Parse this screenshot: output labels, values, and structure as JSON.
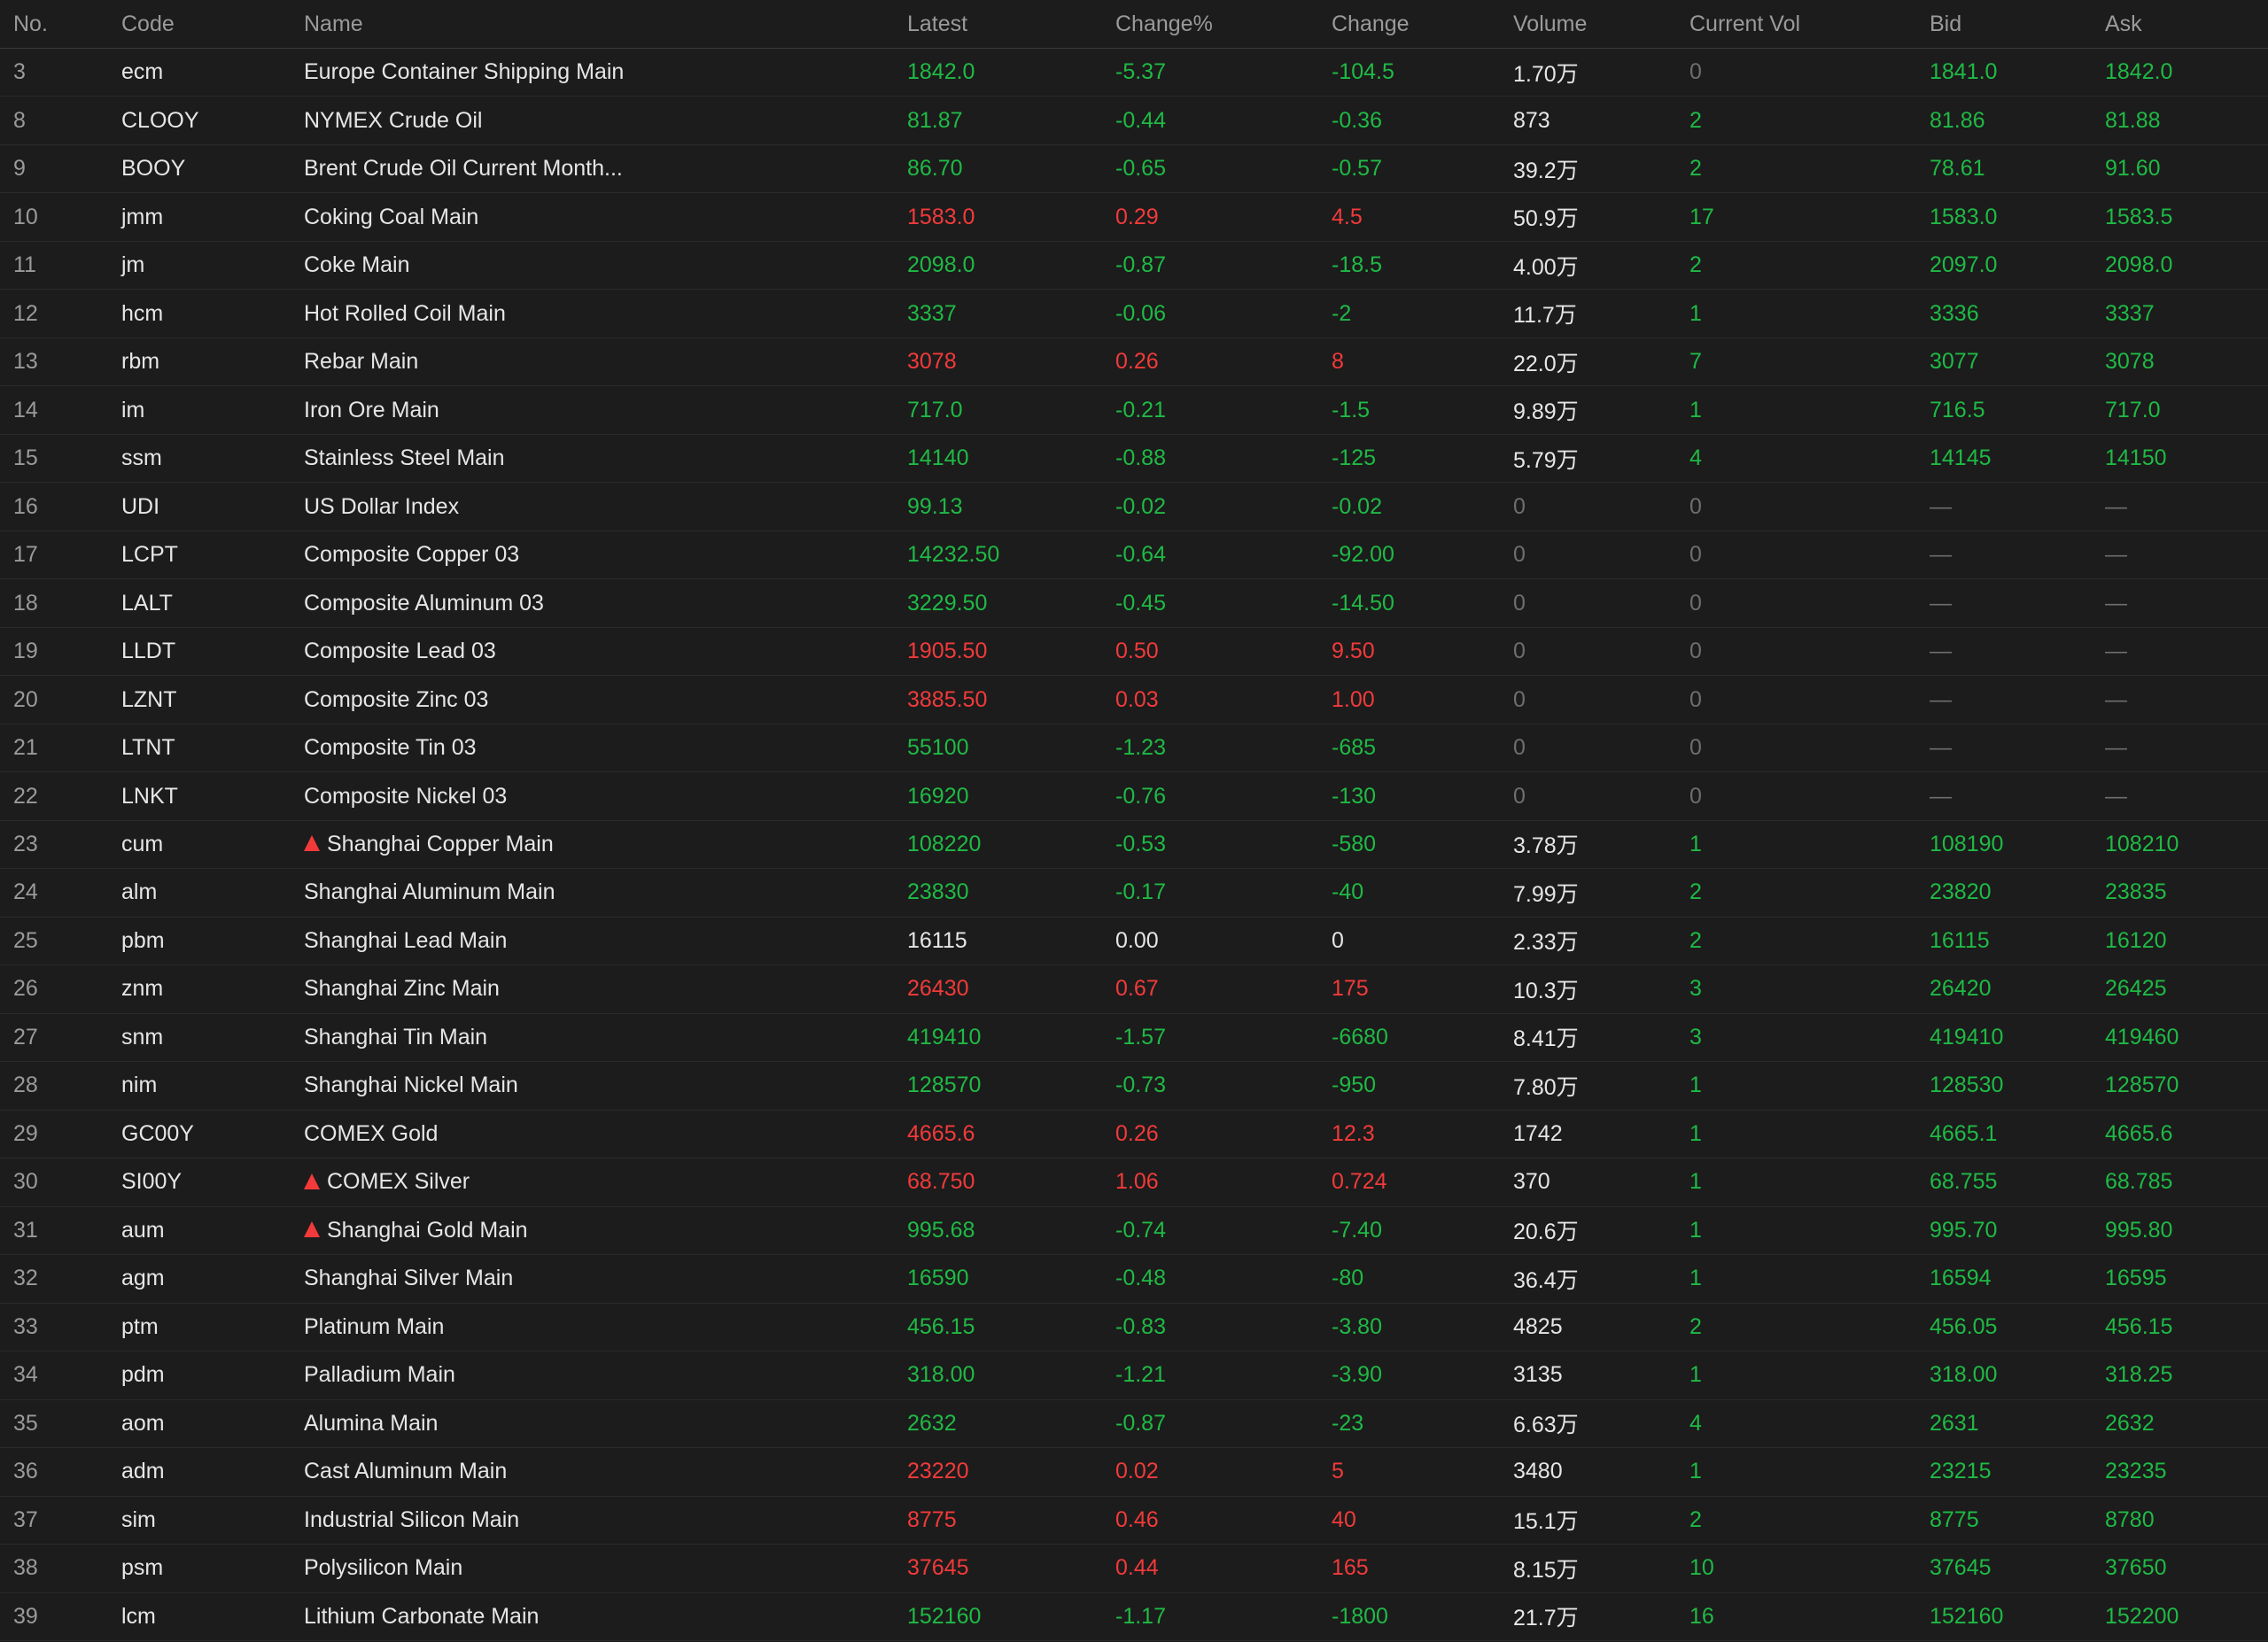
{
  "colors": {
    "background": "#1c1c1c",
    "up": "#f23a3a",
    "down": "#1fba45",
    "text": "#e6e6e6",
    "muted": "#6e6e6e",
    "header_text": "#9a9a9a"
  },
  "table": {
    "headers": {
      "no": "No.",
      "code": "Code",
      "name": "Name",
      "latest": "Latest",
      "change_pct": "Change%",
      "change": "Change",
      "volume": "Volume",
      "current_vol": "Current Vol",
      "bid": "Bid",
      "ask": "Ask"
    },
    "rows": [
      {
        "no": "3",
        "code": "ecm",
        "name": "Europe Container Shipping Main",
        "alert": false,
        "latest": "1842.0",
        "change_pct": "-5.37",
        "change": "-104.5",
        "volume": "1.70万",
        "current_vol": "0",
        "bid": "1841.0",
        "ask": "1842.0",
        "dir": "down"
      },
      {
        "no": "8",
        "code": "CLOOY",
        "name": "NYMEX Crude Oil",
        "alert": false,
        "latest": "81.87",
        "change_pct": "-0.44",
        "change": "-0.36",
        "volume": "873",
        "current_vol": "2",
        "bid": "81.86",
        "ask": "81.88",
        "dir": "down"
      },
      {
        "no": "9",
        "code": "BOOY",
        "name": "Brent Crude Oil Current Month...",
        "alert": false,
        "latest": "86.70",
        "change_pct": "-0.65",
        "change": "-0.57",
        "volume": "39.2万",
        "current_vol": "2",
        "bid": "78.61",
        "ask": "91.60",
        "dir": "down"
      },
      {
        "no": "10",
        "code": "jmm",
        "name": "Coking Coal Main",
        "alert": false,
        "latest": "1583.0",
        "change_pct": "0.29",
        "change": "4.5",
        "volume": "50.9万",
        "current_vol": "17",
        "bid": "1583.0",
        "ask": "1583.5",
        "dir": "up"
      },
      {
        "no": "11",
        "code": "jm",
        "name": "Coke Main",
        "alert": false,
        "latest": "2098.0",
        "change_pct": "-0.87",
        "change": "-18.5",
        "volume": "4.00万",
        "current_vol": "2",
        "bid": "2097.0",
        "ask": "2098.0",
        "dir": "down"
      },
      {
        "no": "12",
        "code": "hcm",
        "name": "Hot Rolled Coil Main",
        "alert": false,
        "latest": "3337",
        "change_pct": "-0.06",
        "change": "-2",
        "volume": "11.7万",
        "current_vol": "1",
        "bid": "3336",
        "ask": "3337",
        "dir": "down"
      },
      {
        "no": "13",
        "code": "rbm",
        "name": "Rebar Main",
        "alert": false,
        "latest": "3078",
        "change_pct": "0.26",
        "change": "8",
        "volume": "22.0万",
        "current_vol": "7",
        "bid": "3077",
        "ask": "3078",
        "dir": "up"
      },
      {
        "no": "14",
        "code": "im",
        "name": "Iron Ore Main",
        "alert": false,
        "latest": "717.0",
        "change_pct": "-0.21",
        "change": "-1.5",
        "volume": "9.89万",
        "current_vol": "1",
        "bid": "716.5",
        "ask": "717.0",
        "dir": "down"
      },
      {
        "no": "15",
        "code": "ssm",
        "name": "Stainless Steel Main",
        "alert": false,
        "latest": "14140",
        "change_pct": "-0.88",
        "change": "-125",
        "volume": "5.79万",
        "current_vol": "4",
        "bid": "14145",
        "ask": "14150",
        "dir": "down"
      },
      {
        "no": "16",
        "code": "UDI",
        "name": "US Dollar Index",
        "alert": false,
        "latest": "99.13",
        "change_pct": "-0.02",
        "change": "-0.02",
        "volume": "0",
        "current_vol": "0",
        "bid": "—",
        "ask": "—",
        "dir": "down"
      },
      {
        "no": "17",
        "code": "LCPT",
        "name": "Composite Copper 03",
        "alert": false,
        "latest": "14232.50",
        "change_pct": "-0.64",
        "change": "-92.00",
        "volume": "0",
        "current_vol": "0",
        "bid": "—",
        "ask": "—",
        "dir": "down"
      },
      {
        "no": "18",
        "code": "LALT",
        "name": "Composite Aluminum 03",
        "alert": false,
        "latest": "3229.50",
        "change_pct": "-0.45",
        "change": "-14.50",
        "volume": "0",
        "current_vol": "0",
        "bid": "—",
        "ask": "—",
        "dir": "down"
      },
      {
        "no": "19",
        "code": "LLDT",
        "name": "Composite Lead 03",
        "alert": false,
        "latest": "1905.50",
        "change_pct": "0.50",
        "change": "9.50",
        "volume": "0",
        "current_vol": "0",
        "bid": "—",
        "ask": "—",
        "dir": "up"
      },
      {
        "no": "20",
        "code": "LZNT",
        "name": "Composite Zinc 03",
        "alert": false,
        "latest": "3885.50",
        "change_pct": "0.03",
        "change": "1.00",
        "volume": "0",
        "current_vol": "0",
        "bid": "—",
        "ask": "—",
        "dir": "up"
      },
      {
        "no": "21",
        "code": "LTNT",
        "name": "Composite Tin 03",
        "alert": false,
        "latest": "55100",
        "change_pct": "-1.23",
        "change": "-685",
        "volume": "0",
        "current_vol": "0",
        "bid": "—",
        "ask": "—",
        "dir": "down"
      },
      {
        "no": "22",
        "code": "LNKT",
        "name": "Composite Nickel 03",
        "alert": false,
        "latest": "16920",
        "change_pct": "-0.76",
        "change": "-130",
        "volume": "0",
        "current_vol": "0",
        "bid": "—",
        "ask": "—",
        "dir": "down"
      },
      {
        "no": "23",
        "code": "cum",
        "name": "Shanghai Copper Main",
        "alert": true,
        "latest": "108220",
        "change_pct": "-0.53",
        "change": "-580",
        "volume": "3.78万",
        "current_vol": "1",
        "bid": "108190",
        "ask": "108210",
        "dir": "down"
      },
      {
        "no": "24",
        "code": "alm",
        "name": "Shanghai Aluminum Main",
        "alert": false,
        "latest": "23830",
        "change_pct": "-0.17",
        "change": "-40",
        "volume": "7.99万",
        "current_vol": "2",
        "bid": "23820",
        "ask": "23835",
        "dir": "down"
      },
      {
        "no": "25",
        "code": "pbm",
        "name": "Shanghai Lead Main",
        "alert": false,
        "latest": "16115",
        "change_pct": "0.00",
        "change": "0",
        "volume": "2.33万",
        "current_vol": "2",
        "bid": "16115",
        "ask": "16120",
        "dir": "flat"
      },
      {
        "no": "26",
        "code": "znm",
        "name": "Shanghai Zinc Main",
        "alert": false,
        "latest": "26430",
        "change_pct": "0.67",
        "change": "175",
        "volume": "10.3万",
        "current_vol": "3",
        "bid": "26420",
        "ask": "26425",
        "dir": "up"
      },
      {
        "no": "27",
        "code": "snm",
        "name": "Shanghai Tin Main",
        "alert": false,
        "latest": "419410",
        "change_pct": "-1.57",
        "change": "-6680",
        "volume": "8.41万",
        "current_vol": "3",
        "bid": "419410",
        "ask": "419460",
        "dir": "down"
      },
      {
        "no": "28",
        "code": "nim",
        "name": "Shanghai Nickel Main",
        "alert": false,
        "latest": "128570",
        "change_pct": "-0.73",
        "change": "-950",
        "volume": "7.80万",
        "current_vol": "1",
        "bid": "128530",
        "ask": "128570",
        "dir": "down"
      },
      {
        "no": "29",
        "code": "GC00Y",
        "name": "COMEX Gold",
        "alert": false,
        "latest": "4665.6",
        "change_pct": "0.26",
        "change": "12.3",
        "volume": "1742",
        "current_vol": "1",
        "bid": "4665.1",
        "ask": "4665.6",
        "dir": "up"
      },
      {
        "no": "30",
        "code": "SI00Y",
        "name": "COMEX Silver",
        "alert": true,
        "latest": "68.750",
        "change_pct": "1.06",
        "change": "0.724",
        "volume": "370",
        "current_vol": "1",
        "bid": "68.755",
        "ask": "68.785",
        "dir": "up"
      },
      {
        "no": "31",
        "code": "aum",
        "name": "Shanghai Gold Main",
        "alert": true,
        "latest": "995.68",
        "change_pct": "-0.74",
        "change": "-7.40",
        "volume": "20.6万",
        "current_vol": "1",
        "bid": "995.70",
        "ask": "995.80",
        "dir": "down"
      },
      {
        "no": "32",
        "code": "agm",
        "name": "Shanghai Silver Main",
        "alert": false,
        "latest": "16590",
        "change_pct": "-0.48",
        "change": "-80",
        "volume": "36.4万",
        "current_vol": "1",
        "bid": "16594",
        "ask": "16595",
        "dir": "down"
      },
      {
        "no": "33",
        "code": "ptm",
        "name": "Platinum Main",
        "alert": false,
        "latest": "456.15",
        "change_pct": "-0.83",
        "change": "-3.80",
        "volume": "4825",
        "current_vol": "2",
        "bid": "456.05",
        "ask": "456.15",
        "dir": "down"
      },
      {
        "no": "34",
        "code": "pdm",
        "name": "Palladium Main",
        "alert": false,
        "latest": "318.00",
        "change_pct": "-1.21",
        "change": "-3.90",
        "volume": "3135",
        "current_vol": "1",
        "bid": "318.00",
        "ask": "318.25",
        "dir": "down"
      },
      {
        "no": "35",
        "code": "aom",
        "name": "Alumina Main",
        "alert": false,
        "latest": "2632",
        "change_pct": "-0.87",
        "change": "-23",
        "volume": "6.63万",
        "current_vol": "4",
        "bid": "2631",
        "ask": "2632",
        "dir": "down"
      },
      {
        "no": "36",
        "code": "adm",
        "name": "Cast Aluminum Main",
        "alert": false,
        "latest": "23220",
        "change_pct": "0.02",
        "change": "5",
        "volume": "3480",
        "current_vol": "1",
        "bid": "23215",
        "ask": "23235",
        "dir": "up"
      },
      {
        "no": "37",
        "code": "sim",
        "name": "Industrial Silicon Main",
        "alert": false,
        "latest": "8775",
        "change_pct": "0.46",
        "change": "40",
        "volume": "15.1万",
        "current_vol": "2",
        "bid": "8775",
        "ask": "8780",
        "dir": "up"
      },
      {
        "no": "38",
        "code": "psm",
        "name": "Polysilicon Main",
        "alert": false,
        "latest": "37645",
        "change_pct": "0.44",
        "change": "165",
        "volume": "8.15万",
        "current_vol": "10",
        "bid": "37645",
        "ask": "37650",
        "dir": "up"
      },
      {
        "no": "39",
        "code": "lcm",
        "name": "Lithium Carbonate Main",
        "alert": false,
        "latest": "152160",
        "change_pct": "-1.17",
        "change": "-1800",
        "volume": "21.7万",
        "current_vol": "16",
        "bid": "152160",
        "ask": "152200",
        "dir": "down"
      }
    ]
  }
}
